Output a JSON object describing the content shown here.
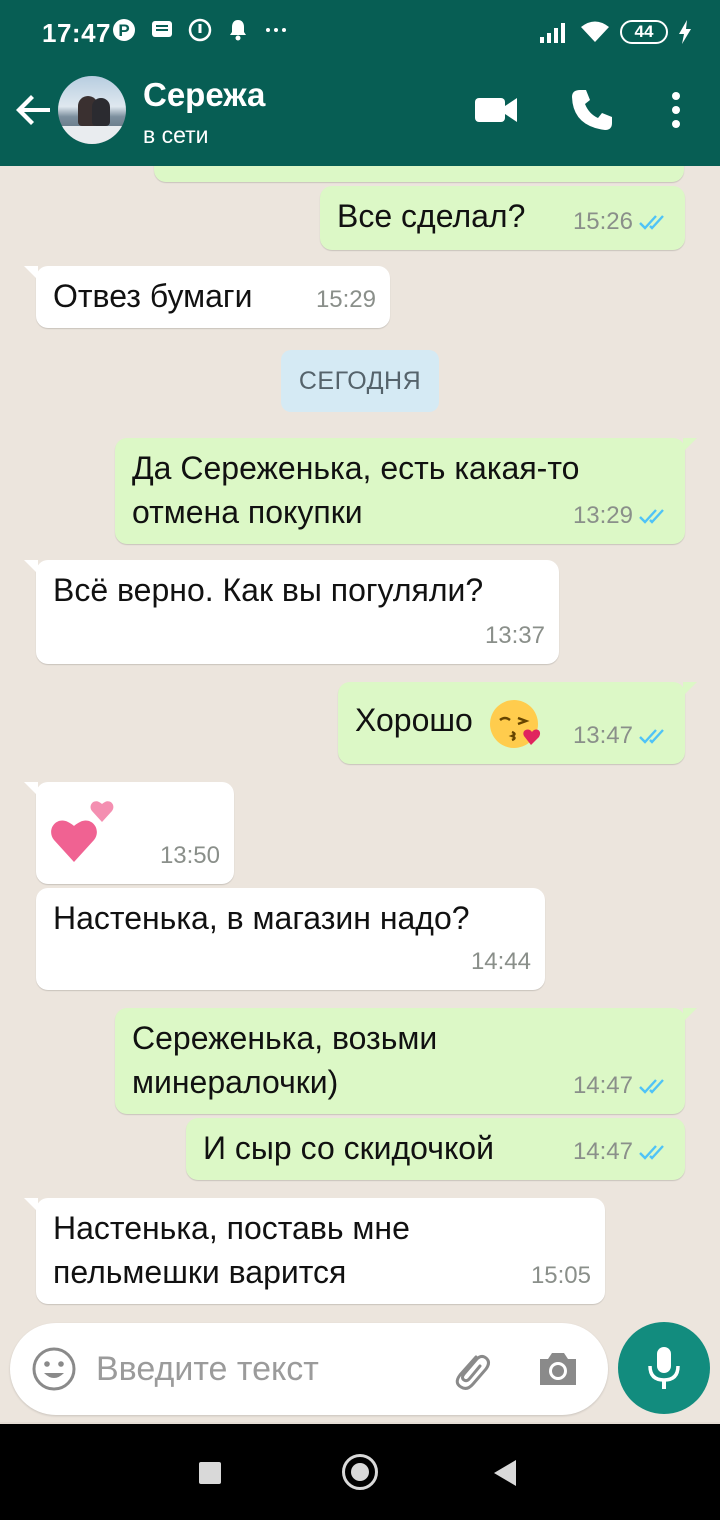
{
  "status_bar": {
    "time": "17:47",
    "battery": "44",
    "icons": [
      "pinterest-icon",
      "message-icon",
      "vpn-icon",
      "bell-icon",
      "more-dots-icon",
      "signal-icon",
      "wifi-icon",
      "battery-icon",
      "charging-icon"
    ]
  },
  "header": {
    "contact_name": "Сережа",
    "status": "в сети",
    "icons": [
      "back-arrow-icon",
      "video-call-icon",
      "phone-icon",
      "more-vert-icon"
    ]
  },
  "chat": {
    "date_divider": "СЕГОДНЯ",
    "messages": [
      {
        "dir": "out",
        "text": "Все сделал?",
        "time": "15:26",
        "read": true
      },
      {
        "dir": "in",
        "text": "Отвез бумаги",
        "time": "15:29"
      },
      {
        "dir": "out",
        "text": "Да Сереженька, есть какая-то\nотмена покупки",
        "time": "13:29",
        "read": true
      },
      {
        "dir": "in",
        "text": "Всё верно. Как вы погуляли?",
        "time": "13:37"
      },
      {
        "dir": "out",
        "text": "Хорошо",
        "emoji": "kissing-face-heart",
        "time": "13:47",
        "read": true
      },
      {
        "dir": "in",
        "text": "",
        "emoji": "two-hearts",
        "time": "13:50"
      },
      {
        "dir": "in",
        "text": "Настенька, в магазин надо?",
        "time": "14:44"
      },
      {
        "dir": "out",
        "text": "Сереженька, возьми\nминералочки)",
        "time": "14:47",
        "read": true
      },
      {
        "dir": "out",
        "text": "И сыр со скидочкой",
        "time": "14:47",
        "read": true
      },
      {
        "dir": "in",
        "text": "Настенька, поставь мне\nпельмешки варится",
        "time": "15:05"
      }
    ]
  },
  "composer": {
    "placeholder": "Введите текст",
    "value": "",
    "icons": [
      "emoji-icon",
      "attach-icon",
      "camera-icon",
      "mic-icon"
    ]
  },
  "colors": {
    "header_bg": "#075e54",
    "outgoing_bubble": "#dcf8c6",
    "incoming_bubble": "#ffffff",
    "chat_bg": "#ece5dd",
    "mic_button": "#128c7e",
    "read_tick": "#4fc3f7",
    "date_chip": "#d5eaf4"
  }
}
